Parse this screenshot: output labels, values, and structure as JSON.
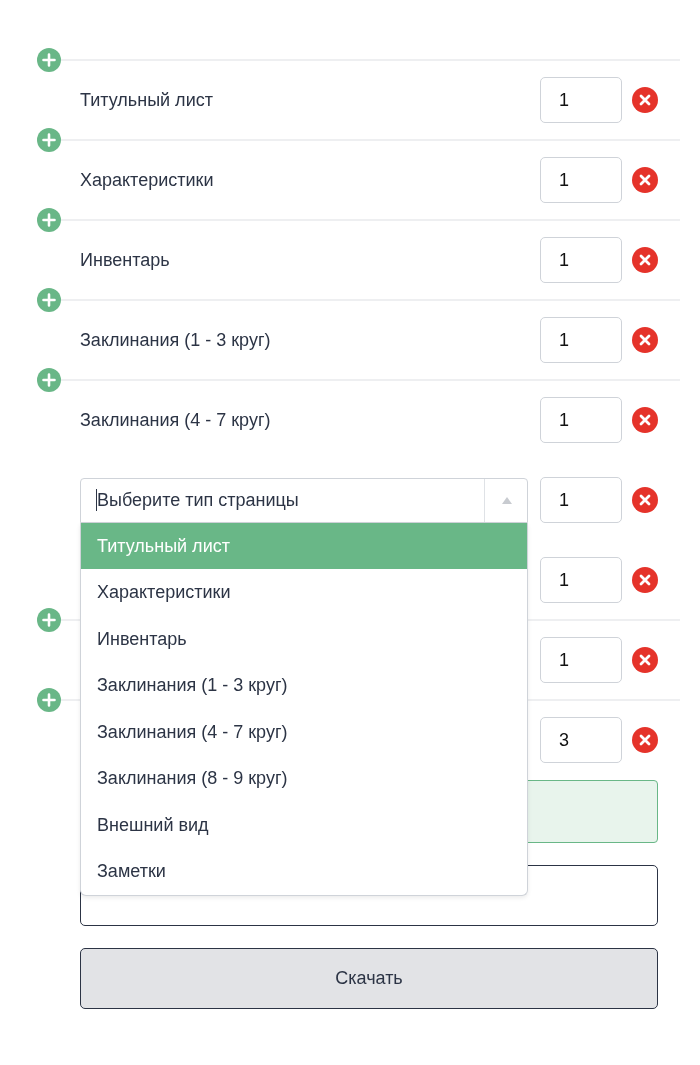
{
  "rows": [
    {
      "kind": "page",
      "add": true,
      "label": "Титульный лист",
      "quantity": "1"
    },
    {
      "kind": "page",
      "add": true,
      "label": "Характеристики",
      "quantity": "1"
    },
    {
      "kind": "page",
      "add": true,
      "label": "Инвентарь",
      "quantity": "1"
    },
    {
      "kind": "page",
      "add": true,
      "label": "Заклинания (1 - 3 круг)",
      "quantity": "1"
    },
    {
      "kind": "page",
      "add": true,
      "label": "Заклинания (4 - 7 круг)",
      "quantity": "1"
    },
    {
      "kind": "select",
      "add": false,
      "placeholder": "Выберите тип страницы",
      "quantity": "1",
      "options": [
        {
          "label": "Титульный лист",
          "selected": true
        },
        {
          "label": "Характеристики",
          "selected": false
        },
        {
          "label": "Инвентарь",
          "selected": false
        },
        {
          "label": "Заклинания (1 - 3 круг)",
          "selected": false
        },
        {
          "label": "Заклинания (4 - 7 круг)",
          "selected": false
        },
        {
          "label": "Заклинания (8 - 9 круг)",
          "selected": false
        },
        {
          "label": "Внешний вид",
          "selected": false
        },
        {
          "label": "Заметки",
          "selected": false
        }
      ]
    },
    {
      "kind": "page",
      "add": false,
      "quantity": "1"
    },
    {
      "kind": "page",
      "add": true,
      "quantity": "1"
    },
    {
      "kind": "page",
      "add": true,
      "quantity": "3"
    }
  ],
  "download_button": "Скачать"
}
